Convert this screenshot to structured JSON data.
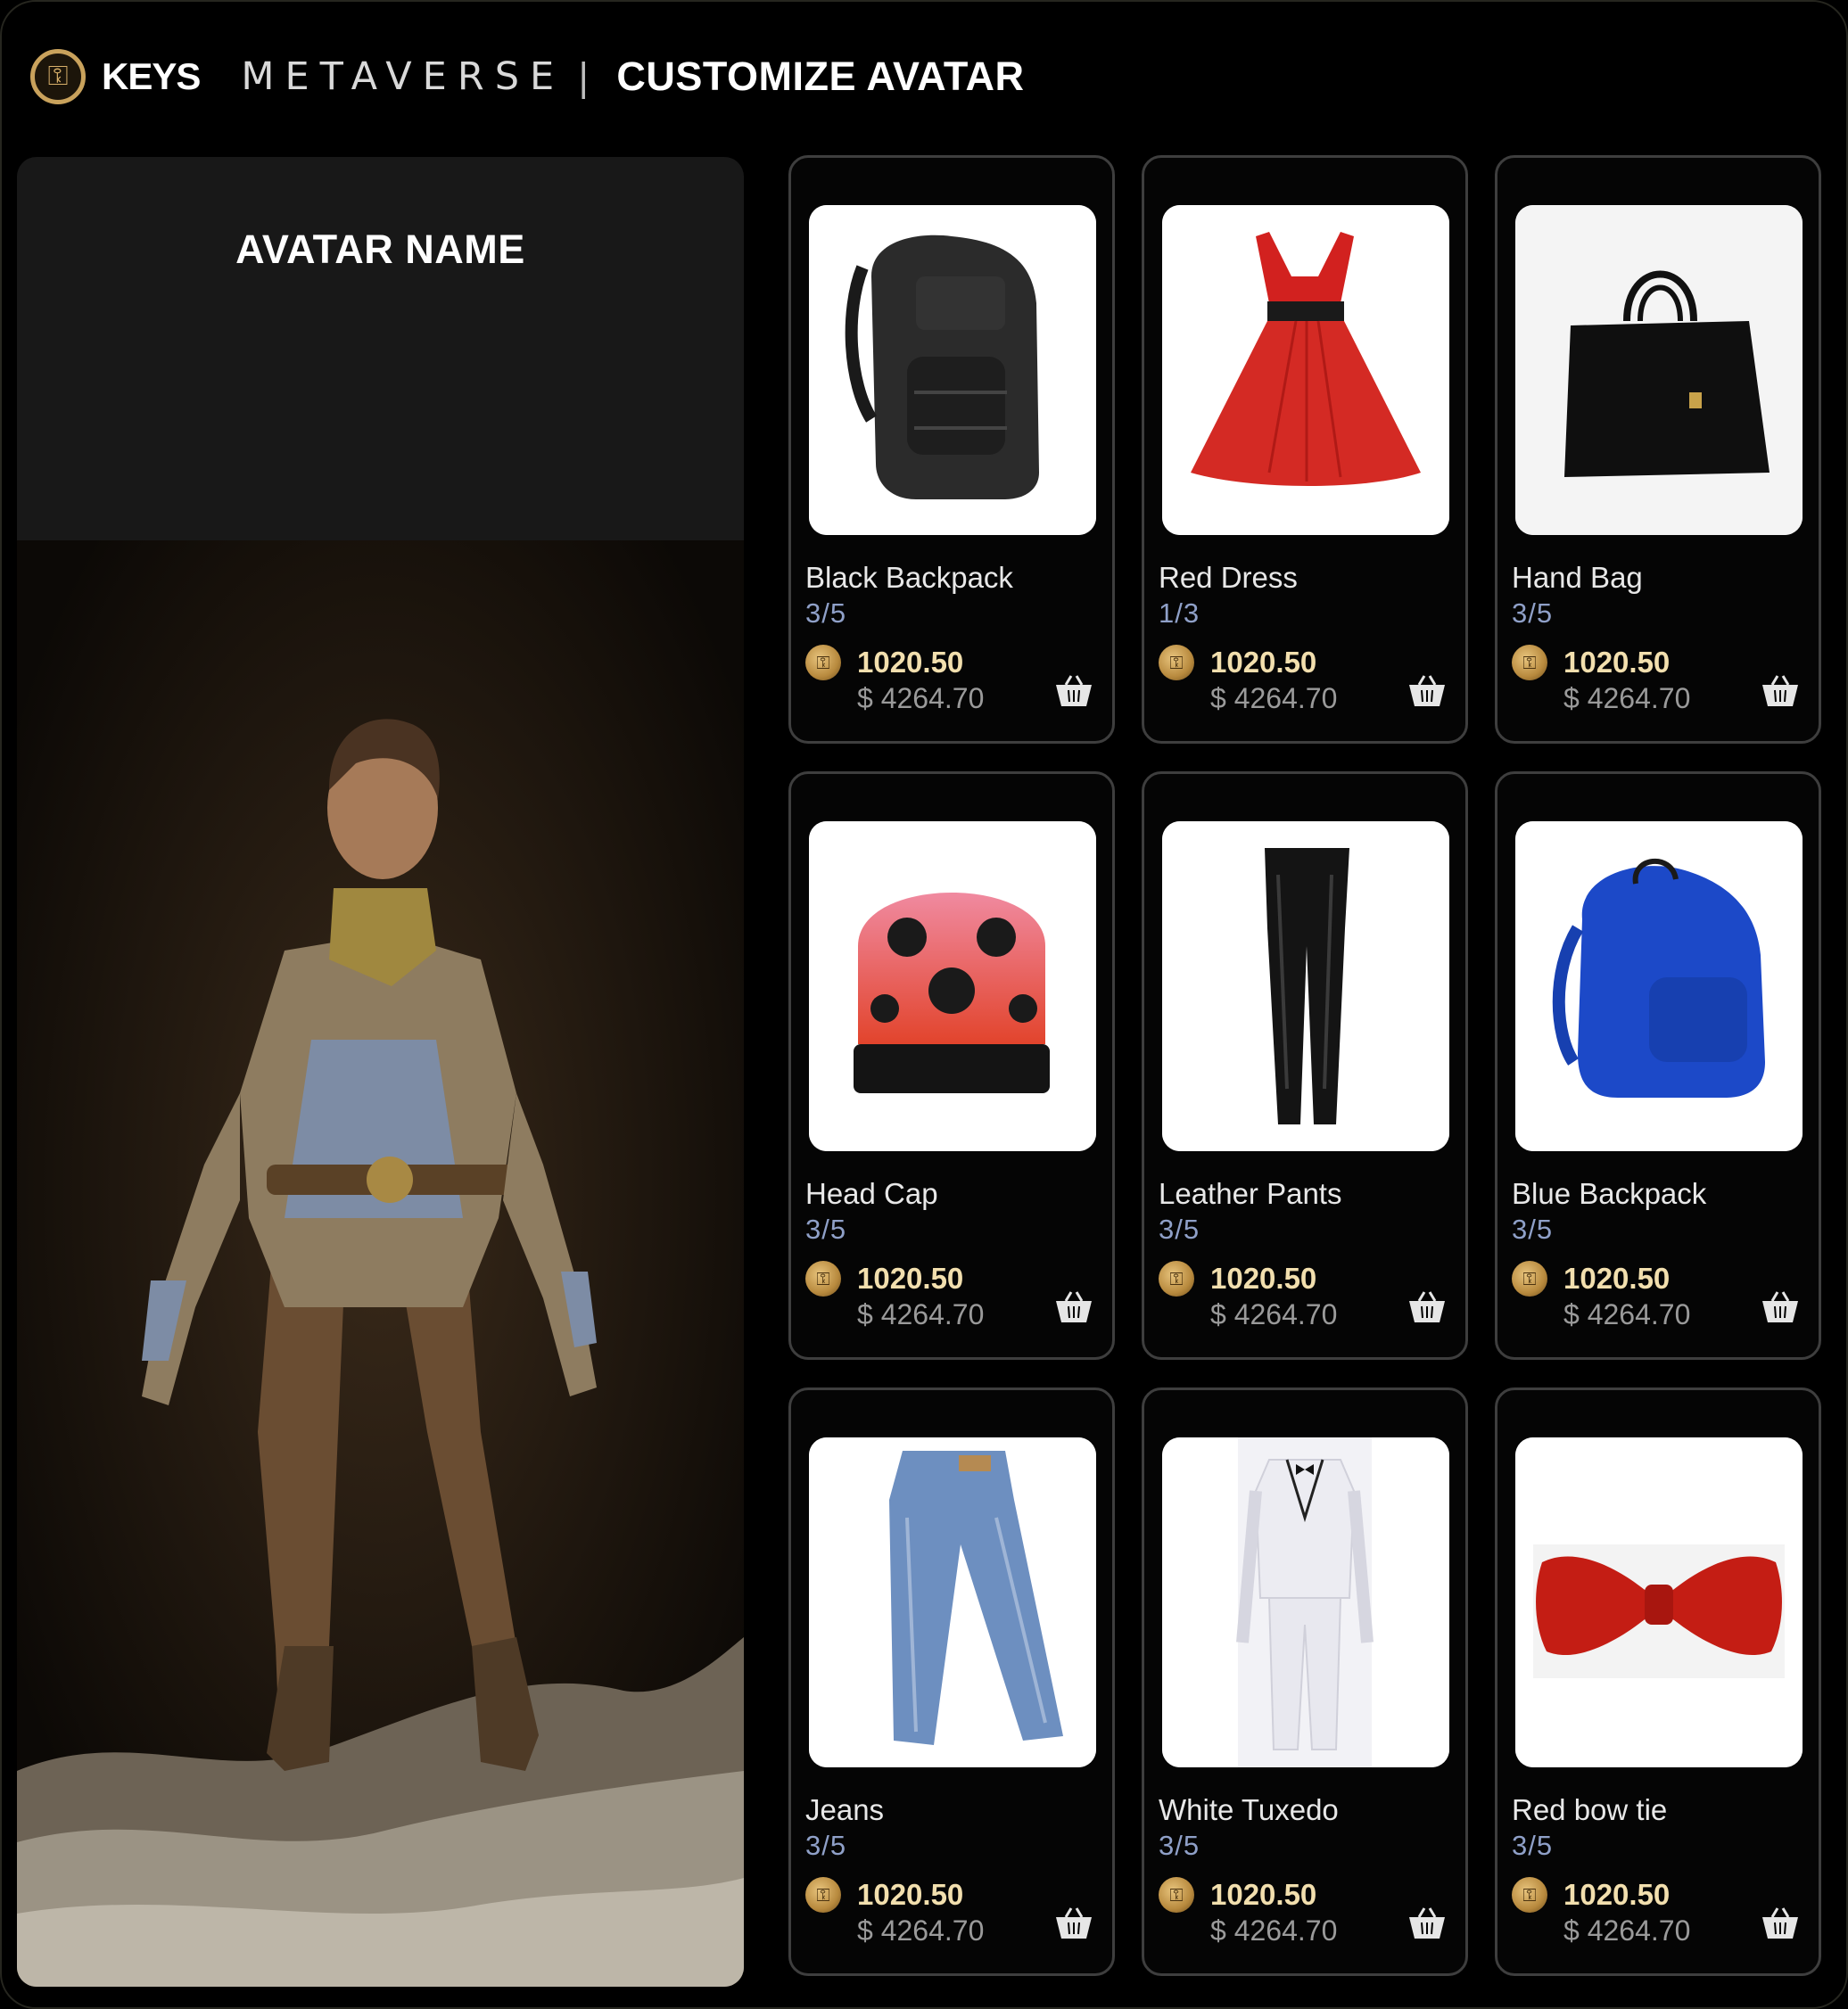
{
  "header": {
    "logo_icon": "keys-coin-logo-icon",
    "brand": "KEYS",
    "section": "METAVERSE",
    "separator": "|",
    "title": "CUSTOMIZE AVATAR"
  },
  "avatar": {
    "name": "AVATAR NAME"
  },
  "products": [
    {
      "name": "Black Backpack",
      "stock": "3/5",
      "price_coin": "1020.50",
      "price_usd": "$ 4264.70",
      "image": "black-backpack"
    },
    {
      "name": "Red Dress",
      "stock": "1/3",
      "price_coin": "1020.50",
      "price_usd": "$ 4264.70",
      "image": "red-dress"
    },
    {
      "name": "Hand Bag",
      "stock": "3/5",
      "price_coin": "1020.50",
      "price_usd": "$ 4264.70",
      "image": "hand-bag"
    },
    {
      "name": "Head Cap",
      "stock": "3/5",
      "price_coin": "1020.50",
      "price_usd": "$ 4264.70",
      "image": "head-cap"
    },
    {
      "name": "Leather Pants",
      "stock": "3/5",
      "price_coin": "1020.50",
      "price_usd": "$ 4264.70",
      "image": "leather-pants"
    },
    {
      "name": "Blue Backpack",
      "stock": "3/5",
      "price_coin": "1020.50",
      "price_usd": "$ 4264.70",
      "image": "blue-backpack"
    },
    {
      "name": "Jeans",
      "stock": "3/5",
      "price_coin": "1020.50",
      "price_usd": "$ 4264.70",
      "image": "jeans"
    },
    {
      "name": "White Tuxedo",
      "stock": "3/5",
      "price_coin": "1020.50",
      "price_usd": "$ 4264.70",
      "image": "white-tuxedo"
    },
    {
      "name": "Red bow tie",
      "stock": "3/5",
      "price_coin": "1020.50",
      "price_usd": "$ 4264.70",
      "image": "red-bow-tie"
    }
  ],
  "icons": {
    "currency": "coin-icon",
    "cart": "basket-icon"
  },
  "colors": {
    "background": "#000000",
    "card_border": "#3e3e3e",
    "coin_price": "#f2dfae",
    "usd_price": "#9a9a9a",
    "stock": "#8fa0c8",
    "gold_accent": "#c9a25c"
  }
}
